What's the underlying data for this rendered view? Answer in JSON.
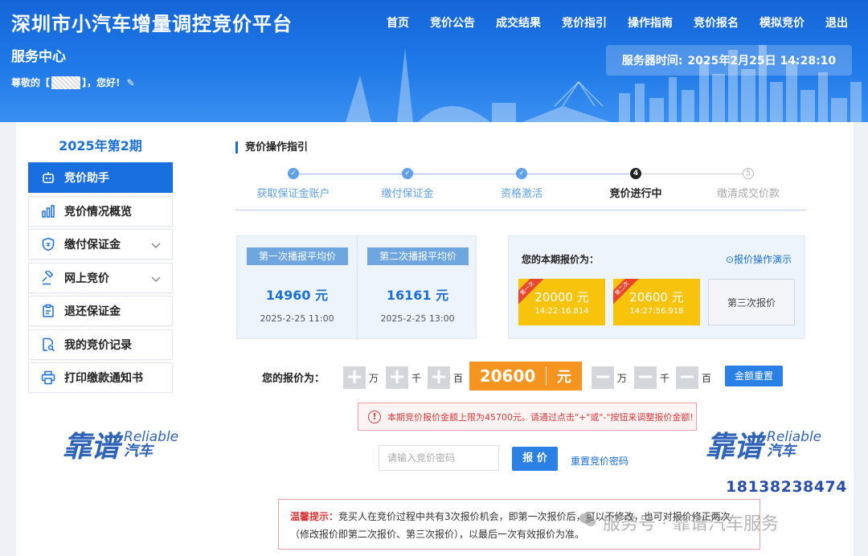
{
  "header": {
    "site_title": "深圳市小汽车增量调控竞价平台",
    "nav": [
      "首页",
      "竞价公告",
      "成交结果",
      "竞价指引",
      "操作指南",
      "竞价报名",
      "模拟竞价",
      "退出"
    ],
    "service_center": "服务中心",
    "greeting_prefix": "尊敬的【",
    "greeting_suffix": "】，您好!",
    "server_time_label": "服务器时间:",
    "server_time_value": "2025年2月25日 14:28:10"
  },
  "sidebar": {
    "period": "2025年第2期",
    "items": [
      {
        "label": "竞价助手",
        "icon": "robot-icon",
        "active": true
      },
      {
        "label": "竞价情况概览",
        "icon": "bar-chart-icon"
      },
      {
        "label": "缴付保证金",
        "icon": "shield-icon",
        "expand": true
      },
      {
        "label": "网上竞价",
        "icon": "gavel-icon",
        "expand": true
      },
      {
        "label": "退还保证金",
        "icon": "clipboard-icon"
      },
      {
        "label": "我的竞价记录",
        "icon": "document-search-icon"
      },
      {
        "label": "打印缴款通知书",
        "icon": "printer-icon"
      }
    ]
  },
  "guide": {
    "title": "竞价操作指引",
    "steps": [
      {
        "label": "获取保证金账户",
        "state": "done",
        "mark": "✓"
      },
      {
        "label": "缴付保证金",
        "state": "done",
        "mark": "✓"
      },
      {
        "label": "资格激活",
        "state": "done",
        "mark": "✓"
      },
      {
        "label": "竞价进行中",
        "state": "current",
        "mark": "4"
      },
      {
        "label": "缴清成交价款",
        "state": "todo",
        "mark": "5"
      }
    ]
  },
  "broadcast": [
    {
      "tag": "第一次播报平均价",
      "value": "14960 元",
      "time": "2025-2-25 11:00"
    },
    {
      "tag": "第二次播报平均价",
      "value": "16161 元",
      "time": "2025-2-25 13:00"
    }
  ],
  "my_bids": {
    "label": "您的本期报价为：",
    "demo_link": "⊙报价操作演示",
    "bids": [
      {
        "ribbon": "第一次",
        "amount": "20000 元",
        "time": "14:22:16.814"
      },
      {
        "ribbon": "第二次",
        "amount": "20600 元",
        "time": "14:27:56.918"
      }
    ],
    "third": "第三次报价"
  },
  "price_input": {
    "label": "您的报价为：",
    "plus_units": [
      "万",
      "千",
      "百"
    ],
    "minus_units": [
      "万",
      "千",
      "百"
    ],
    "value": "20600",
    "currency": "元",
    "reset_label": "金额重置"
  },
  "warning": {
    "text": "本期竞价报价金额上限为45700元。请通过点击\"+\"或\"-\"按钮来调整报价金额!"
  },
  "password": {
    "placeholder": "请输入竞价密码",
    "bid_button": "报 价",
    "reset_link": "重置竞价密码"
  },
  "tip": {
    "title": "温馨提示：",
    "text": "竞买人在竞价过程中共有3次报价机会，即第一次报价后，可以不修改，也可对报价修正两次（修改报价即第二次报价、第三次报价），以最后一次有效报价为准。"
  },
  "watermark": {
    "brand": "靠谱",
    "brand_en": "Reliable",
    "brand_zh": "汽车",
    "phone": "18138238474",
    "footer": "服务号 · 靠谱汽车服务"
  },
  "colors": {
    "primary": "#1a6fe0",
    "bid_card": "#f7c30b",
    "price_box": "#f5941e",
    "warning": "#d83a3a"
  }
}
